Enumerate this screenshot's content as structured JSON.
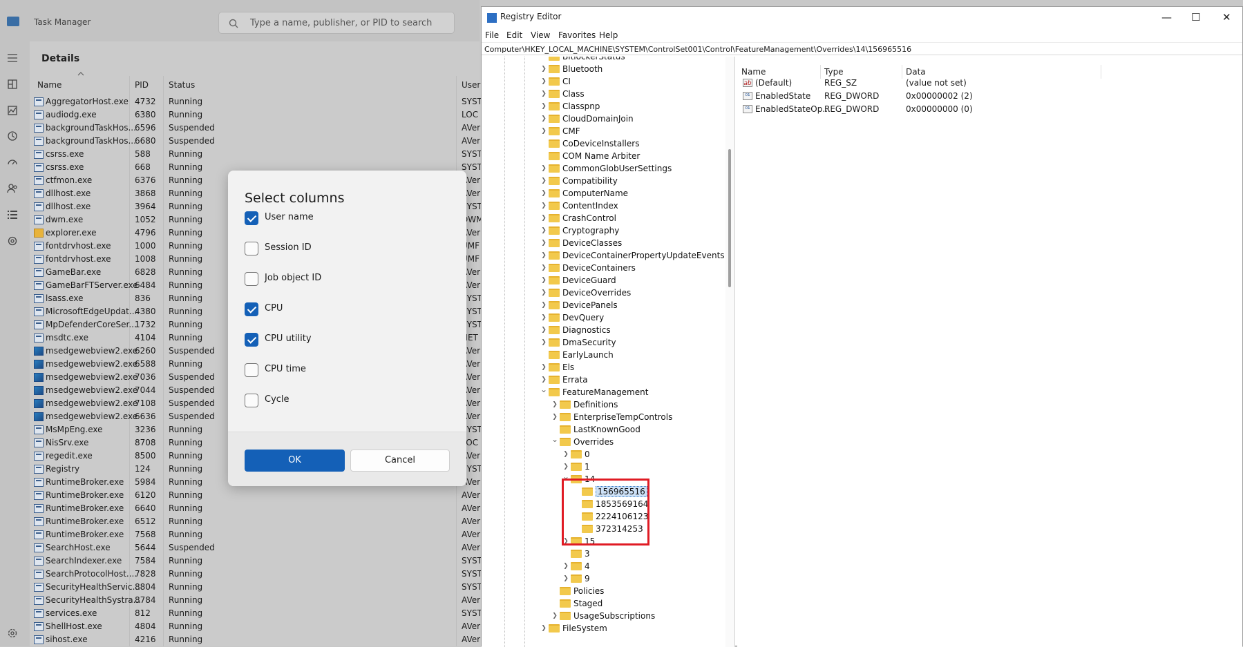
{
  "task_manager": {
    "title": "Task Manager",
    "search_placeholder": "Type a name, publisher, or PID to search",
    "section_title": "Details",
    "columns": [
      "Name",
      "PID",
      "Status",
      "User"
    ],
    "rows": [
      {
        "name": "AggregatorHost.exe",
        "pid": "4732",
        "status": "Running",
        "user": "SYST",
        "icon": "app"
      },
      {
        "name": "audiodg.exe",
        "pid": "6380",
        "status": "Running",
        "user": "LOC",
        "icon": "app"
      },
      {
        "name": "backgroundTaskHos...",
        "pid": "6596",
        "status": "Suspended",
        "user": "AVer",
        "icon": "app"
      },
      {
        "name": "backgroundTaskHos...",
        "pid": "6680",
        "status": "Suspended",
        "user": "AVer",
        "icon": "app"
      },
      {
        "name": "csrss.exe",
        "pid": "588",
        "status": "Running",
        "user": "SYST",
        "icon": "app"
      },
      {
        "name": "csrss.exe",
        "pid": "668",
        "status": "Running",
        "user": "SYST",
        "icon": "app"
      },
      {
        "name": "ctfmon.exe",
        "pid": "6376",
        "status": "Running",
        "user": "AVer",
        "icon": "app"
      },
      {
        "name": "dllhost.exe",
        "pid": "3868",
        "status": "Running",
        "user": "AVer",
        "icon": "app"
      },
      {
        "name": "dllhost.exe",
        "pid": "3964",
        "status": "Running",
        "user": "SYST",
        "icon": "app"
      },
      {
        "name": "dwm.exe",
        "pid": "1052",
        "status": "Running",
        "user": "DWM",
        "icon": "app"
      },
      {
        "name": "explorer.exe",
        "pid": "4796",
        "status": "Running",
        "user": "AVer",
        "icon": "folder"
      },
      {
        "name": "fontdrvhost.exe",
        "pid": "1000",
        "status": "Running",
        "user": "UMF",
        "icon": "app"
      },
      {
        "name": "fontdrvhost.exe",
        "pid": "1008",
        "status": "Running",
        "user": "UMF",
        "icon": "app"
      },
      {
        "name": "GameBar.exe",
        "pid": "6828",
        "status": "Running",
        "user": "AVer",
        "icon": "app"
      },
      {
        "name": "GameBarFTServer.exe",
        "pid": "6484",
        "status": "Running",
        "user": "AVer",
        "icon": "app"
      },
      {
        "name": "lsass.exe",
        "pid": "836",
        "status": "Running",
        "user": "SYST",
        "icon": "app"
      },
      {
        "name": "MicrosoftEdgeUpdat...",
        "pid": "4380",
        "status": "Running",
        "user": "SYST",
        "icon": "app"
      },
      {
        "name": "MpDefenderCoreSer...",
        "pid": "1732",
        "status": "Running",
        "user": "SYST",
        "icon": "app"
      },
      {
        "name": "msdtc.exe",
        "pid": "4104",
        "status": "Running",
        "user": "NET",
        "icon": "app"
      },
      {
        "name": "msedgewebview2.exe",
        "pid": "6260",
        "status": "Suspended",
        "user": "AVer",
        "icon": "webview"
      },
      {
        "name": "msedgewebview2.exe",
        "pid": "6588",
        "status": "Running",
        "user": "AVer",
        "icon": "webview"
      },
      {
        "name": "msedgewebview2.exe",
        "pid": "7036",
        "status": "Suspended",
        "user": "AVer",
        "icon": "webview"
      },
      {
        "name": "msedgewebview2.exe",
        "pid": "7044",
        "status": "Suspended",
        "user": "AVer",
        "icon": "webview"
      },
      {
        "name": "msedgewebview2.exe",
        "pid": "7108",
        "status": "Suspended",
        "user": "AVer",
        "icon": "webview"
      },
      {
        "name": "msedgewebview2.exe",
        "pid": "6636",
        "status": "Suspended",
        "user": "AVer",
        "icon": "webview"
      },
      {
        "name": "MsMpEng.exe",
        "pid": "3236",
        "status": "Running",
        "user": "SYST",
        "icon": "app"
      },
      {
        "name": "NisSrv.exe",
        "pid": "8708",
        "status": "Running",
        "user": "LOC",
        "icon": "app"
      },
      {
        "name": "regedit.exe",
        "pid": "8500",
        "status": "Running",
        "user": "AVer",
        "icon": "app"
      },
      {
        "name": "Registry",
        "pid": "124",
        "status": "Running",
        "user": "SYST",
        "icon": "app"
      },
      {
        "name": "RuntimeBroker.exe",
        "pid": "5984",
        "status": "Running",
        "user": "AVer",
        "icon": "app"
      },
      {
        "name": "RuntimeBroker.exe",
        "pid": "6120",
        "status": "Running",
        "user": "AVer",
        "icon": "app"
      },
      {
        "name": "RuntimeBroker.exe",
        "pid": "6640",
        "status": "Running",
        "user": "AVer",
        "icon": "app"
      },
      {
        "name": "RuntimeBroker.exe",
        "pid": "6512",
        "status": "Running",
        "user": "AVer",
        "icon": "app"
      },
      {
        "name": "RuntimeBroker.exe",
        "pid": "7568",
        "status": "Running",
        "user": "AVer",
        "icon": "app"
      },
      {
        "name": "SearchHost.exe",
        "pid": "5644",
        "status": "Suspended",
        "user": "AVer",
        "icon": "app"
      },
      {
        "name": "SearchIndexer.exe",
        "pid": "7584",
        "status": "Running",
        "user": "SYST",
        "icon": "app"
      },
      {
        "name": "SearchProtocolHost....",
        "pid": "7828",
        "status": "Running",
        "user": "SYST",
        "icon": "app"
      },
      {
        "name": "SecurityHealthServic...",
        "pid": "8804",
        "status": "Running",
        "user": "SYST",
        "icon": "app"
      },
      {
        "name": "SecurityHealthSystra...",
        "pid": "8784",
        "status": "Running",
        "user": "AVer",
        "icon": "app"
      },
      {
        "name": "services.exe",
        "pid": "812",
        "status": "Running",
        "user": "SYST",
        "icon": "app"
      },
      {
        "name": "ShellHost.exe",
        "pid": "4804",
        "status": "Running",
        "user": "AVer",
        "icon": "app"
      },
      {
        "name": "sihost.exe",
        "pid": "4216",
        "status": "Running",
        "user": "AVer",
        "icon": "app"
      }
    ]
  },
  "dialog": {
    "title": "Select columns",
    "options": [
      {
        "label": "User name",
        "checked": true
      },
      {
        "label": "Session ID",
        "checked": false
      },
      {
        "label": "Job object ID",
        "checked": false
      },
      {
        "label": "CPU",
        "checked": true
      },
      {
        "label": "CPU utility",
        "checked": true
      },
      {
        "label": "CPU time",
        "checked": false
      },
      {
        "label": "Cycle",
        "checked": false
      }
    ],
    "ok_label": "OK",
    "cancel_label": "Cancel"
  },
  "registry": {
    "title": "Registry Editor",
    "menu": [
      "File",
      "Edit",
      "View",
      "Favorites",
      "Help"
    ],
    "address": "Computer\\HKEY_LOCAL_MACHINE\\SYSTEM\\ControlSet001\\Control\\FeatureManagement\\Overrides\\14\\156965516",
    "tree": [
      {
        "label": "BitlockerStatus",
        "level": 0,
        "expander": "none"
      },
      {
        "label": "Bluetooth",
        "level": 0,
        "expander": "collapsed"
      },
      {
        "label": "CI",
        "level": 0,
        "expander": "collapsed"
      },
      {
        "label": "Class",
        "level": 0,
        "expander": "collapsed"
      },
      {
        "label": "Classpnp",
        "level": 0,
        "expander": "collapsed"
      },
      {
        "label": "CloudDomainJoin",
        "level": 0,
        "expander": "collapsed"
      },
      {
        "label": "CMF",
        "level": 0,
        "expander": "collapsed"
      },
      {
        "label": "CoDeviceInstallers",
        "level": 0,
        "expander": "none"
      },
      {
        "label": "COM Name Arbiter",
        "level": 0,
        "expander": "none"
      },
      {
        "label": "CommonGlobUserSettings",
        "level": 0,
        "expander": "collapsed"
      },
      {
        "label": "Compatibility",
        "level": 0,
        "expander": "collapsed"
      },
      {
        "label": "ComputerName",
        "level": 0,
        "expander": "collapsed"
      },
      {
        "label": "ContentIndex",
        "level": 0,
        "expander": "collapsed"
      },
      {
        "label": "CrashControl",
        "level": 0,
        "expander": "collapsed"
      },
      {
        "label": "Cryptography",
        "level": 0,
        "expander": "collapsed"
      },
      {
        "label": "DeviceClasses",
        "level": 0,
        "expander": "collapsed"
      },
      {
        "label": "DeviceContainerPropertyUpdateEvents",
        "level": 0,
        "expander": "collapsed"
      },
      {
        "label": "DeviceContainers",
        "level": 0,
        "expander": "collapsed"
      },
      {
        "label": "DeviceGuard",
        "level": 0,
        "expander": "collapsed"
      },
      {
        "label": "DeviceOverrides",
        "level": 0,
        "expander": "collapsed"
      },
      {
        "label": "DevicePanels",
        "level": 0,
        "expander": "collapsed"
      },
      {
        "label": "DevQuery",
        "level": 0,
        "expander": "collapsed"
      },
      {
        "label": "Diagnostics",
        "level": 0,
        "expander": "collapsed"
      },
      {
        "label": "DmaSecurity",
        "level": 0,
        "expander": "collapsed"
      },
      {
        "label": "EarlyLaunch",
        "level": 0,
        "expander": "none"
      },
      {
        "label": "Els",
        "level": 0,
        "expander": "collapsed"
      },
      {
        "label": "Errata",
        "level": 0,
        "expander": "collapsed"
      },
      {
        "label": "FeatureManagement",
        "level": 0,
        "expander": "expanded"
      },
      {
        "label": "Definitions",
        "level": 1,
        "expander": "collapsed"
      },
      {
        "label": "EnterpriseTempControls",
        "level": 1,
        "expander": "collapsed"
      },
      {
        "label": "LastKnownGood",
        "level": 1,
        "expander": "none"
      },
      {
        "label": "Overrides",
        "level": 1,
        "expander": "expanded"
      },
      {
        "label": "0",
        "level": 2,
        "expander": "collapsed"
      },
      {
        "label": "1",
        "level": 2,
        "expander": "collapsed"
      },
      {
        "label": "14",
        "level": 2,
        "expander": "expanded"
      },
      {
        "label": "156965516",
        "level": 3,
        "expander": "none",
        "selected": true
      },
      {
        "label": "1853569164",
        "level": 3,
        "expander": "none"
      },
      {
        "label": "2224106123",
        "level": 3,
        "expander": "none"
      },
      {
        "label": "372314253",
        "level": 3,
        "expander": "none"
      },
      {
        "label": "15",
        "level": 2,
        "expander": "collapsed"
      },
      {
        "label": "3",
        "level": 2,
        "expander": "none"
      },
      {
        "label": "4",
        "level": 2,
        "expander": "collapsed"
      },
      {
        "label": "9",
        "level": 2,
        "expander": "collapsed"
      },
      {
        "label": "Policies",
        "level": 1,
        "expander": "none"
      },
      {
        "label": "Staged",
        "level": 1,
        "expander": "none"
      },
      {
        "label": "UsageSubscriptions",
        "level": 1,
        "expander": "collapsed"
      },
      {
        "label": "FileSystem",
        "level": 0,
        "expander": "collapsed"
      }
    ],
    "value_columns": [
      "Name",
      "Type",
      "Data"
    ],
    "values": [
      {
        "name": "(Default)",
        "type": "REG_SZ",
        "data": "(value not set)",
        "icon": "ab"
      },
      {
        "name": "EnabledState",
        "type": "REG_DWORD",
        "data": "0x00000002 (2)",
        "icon": "010"
      },
      {
        "name": "EnabledStateOp...",
        "type": "REG_DWORD",
        "data": "0x00000000 (0)",
        "icon": "010"
      }
    ]
  }
}
